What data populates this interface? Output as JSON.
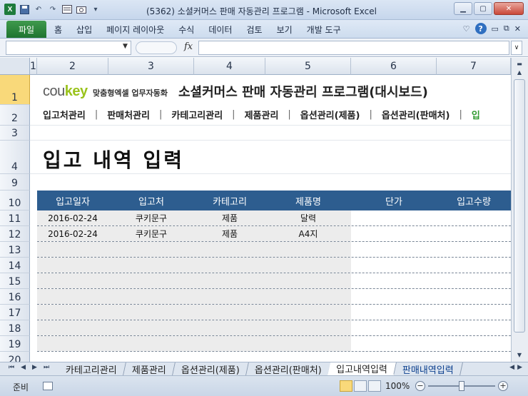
{
  "window": {
    "title": "(5362) 소셜커머스 판매 자동관리 프로그램 - Microsoft Excel",
    "min_icon": "minimize-icon",
    "max_icon": "maximize-icon",
    "close_icon": "close-icon"
  },
  "ribbon": {
    "file_tab": "파일",
    "tabs": [
      "홈",
      "삽입",
      "페이지 레이아웃",
      "수식",
      "데이터",
      "검토",
      "보기",
      "개발 도구"
    ],
    "help": "?"
  },
  "formula_bar": {
    "name_box": "",
    "fx": "fx",
    "formula": ""
  },
  "columns": [
    "1",
    "2",
    "3",
    "4",
    "5",
    "6",
    "7"
  ],
  "rows": [
    "1",
    "2",
    "3",
    "4",
    "9",
    "10",
    "11",
    "12",
    "13",
    "14",
    "15",
    "16",
    "17",
    "18",
    "19",
    "20"
  ],
  "sheet": {
    "logo_brand_left": "cou",
    "logo_brand_right": "key",
    "logo_tagline": "맞춤형엑셀 업무자동화",
    "app_title": "소셜커머스 판매 자동관리 프로그램(대시보드)",
    "nav": [
      "입고처관리",
      "판매처관리",
      "카테고리관리",
      "제품관리",
      "옵션관리(제품)",
      "옵션관리(판매처)",
      "입"
    ],
    "nav_separator": "|",
    "page_title": "입고 내역 입력",
    "table": {
      "headers": [
        "입고일자",
        "입고처",
        "카테고리",
        "제품명",
        "단가",
        "입고수량"
      ],
      "rows": [
        [
          "2016-02-24",
          "쿠키문구",
          "제품",
          "달력",
          "",
          ""
        ],
        [
          "2016-02-24",
          "쿠키문구",
          "제품",
          "A4지",
          "",
          ""
        ],
        [
          "",
          "",
          "",
          "",
          "",
          ""
        ],
        [
          "",
          "",
          "",
          "",
          "",
          ""
        ],
        [
          "",
          "",
          "",
          "",
          "",
          ""
        ],
        [
          "",
          "",
          "",
          "",
          "",
          ""
        ],
        [
          "",
          "",
          "",
          "",
          "",
          ""
        ],
        [
          "",
          "",
          "",
          "",
          "",
          ""
        ],
        [
          "",
          "",
          "",
          "",
          "",
          ""
        ]
      ]
    }
  },
  "sheet_tabs": [
    "카테고리관리",
    "제품관리",
    "옵션관리(제품)",
    "옵션관리(판매처)",
    "입고내역입력",
    "판매내역입력"
  ],
  "active_sheet_tab": "입고내역입력",
  "status": {
    "ready": "준비",
    "zoom": "100%",
    "zoom_minus": "−",
    "zoom_plus": "+"
  }
}
